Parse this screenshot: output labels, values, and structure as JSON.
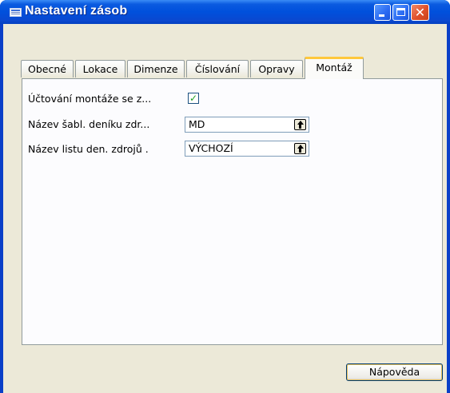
{
  "window": {
    "title": "Nastavení zásob"
  },
  "tabs": [
    {
      "label": "Obecné"
    },
    {
      "label": "Lokace"
    },
    {
      "label": "Dimenze"
    },
    {
      "label": "Číslování"
    },
    {
      "label": "Opravy"
    },
    {
      "label": "Montáž",
      "active": true
    }
  ],
  "fields": {
    "posting": {
      "label": "Účtování montáže se z...",
      "checked": true
    },
    "template": {
      "label": "Název šabl. deníku zdr...",
      "value": "MD"
    },
    "batch": {
      "label": "Název listu den. zdrojů  .",
      "value": "VÝCHOZÍ"
    }
  },
  "footer": {
    "help_label": "Nápověda"
  },
  "icons": {
    "title": "form-window-icon",
    "lookup": "lookup-arrow-icon",
    "check": "checkmark-icon"
  },
  "colors": {
    "titlebar": "#0050dc",
    "active_tab_accent": "#ffc83c",
    "check": "#21a121"
  }
}
